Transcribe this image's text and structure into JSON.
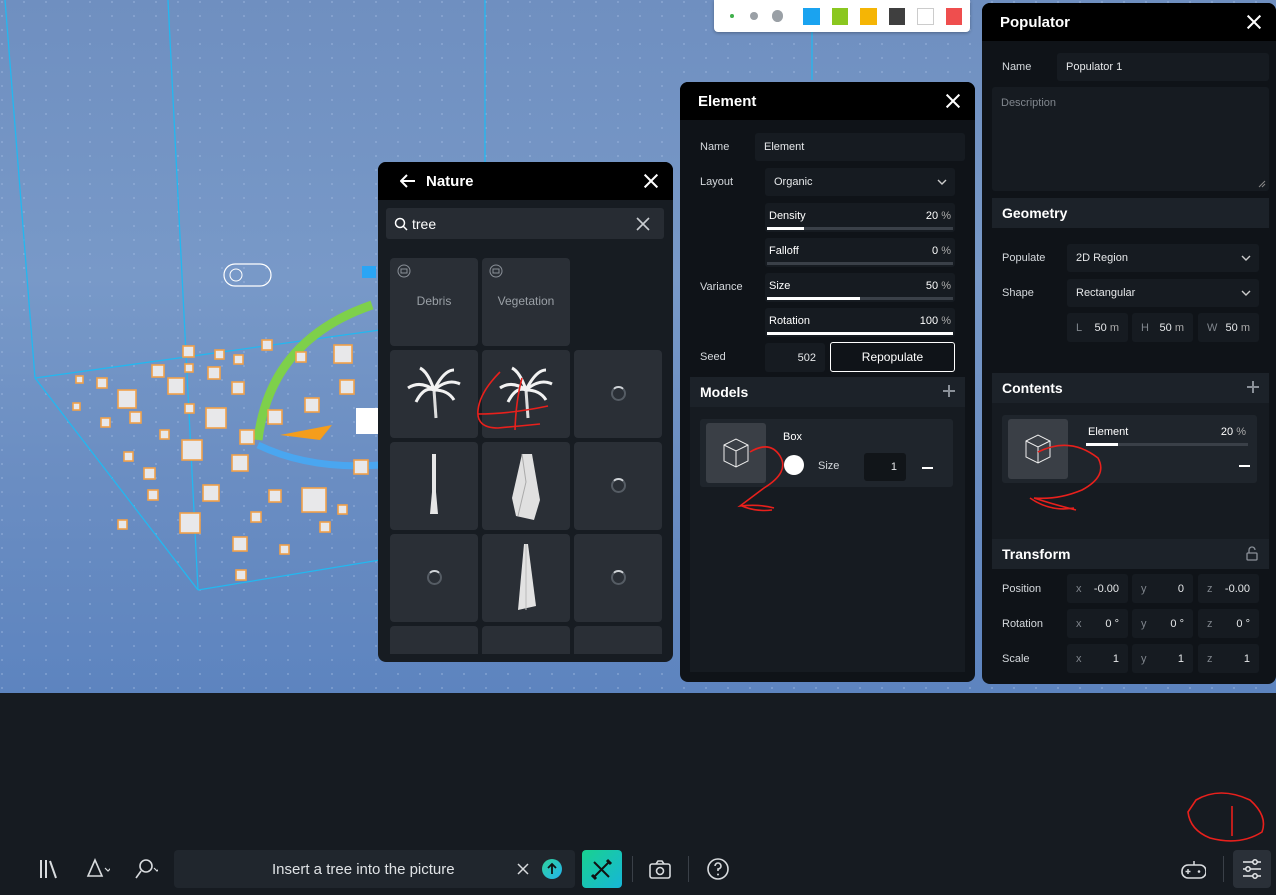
{
  "color_toolbar": {
    "brush_sizes": [
      "small",
      "medium",
      "large"
    ],
    "swatches": [
      "#1aa3f0",
      "#8ac720",
      "#f5b505",
      "#3f3f3f",
      "#ffffff",
      "#ef4e4e"
    ]
  },
  "nature_panel": {
    "title": "Nature",
    "search_value": "tree",
    "folders": [
      "Debris",
      "Vegetation"
    ]
  },
  "element_panel": {
    "title": "Element",
    "name_label": "Name",
    "name_value": "Element",
    "layout_label": "Layout",
    "layout_value": "Organic",
    "density": {
      "label": "Density",
      "value": "20",
      "unit": "%",
      "fraction": 0.2
    },
    "falloff": {
      "label": "Falloff",
      "value": "0",
      "unit": "%",
      "fraction": 0.0
    },
    "variance_label": "Variance",
    "size": {
      "label": "Size",
      "value": "50",
      "unit": "%",
      "fraction": 0.5
    },
    "rotation": {
      "label": "Rotation",
      "value": "100",
      "unit": "%",
      "fraction": 1.0
    },
    "seed_label": "Seed",
    "seed_value": "502",
    "repopulate_label": "Repopulate",
    "models_title": "Models",
    "model": {
      "name": "Box",
      "size_label": "Size",
      "size_value": "1"
    }
  },
  "populator_panel": {
    "title": "Populator",
    "name_label": "Name",
    "name_value": "Populator 1",
    "description_placeholder": "Description",
    "geometry_title": "Geometry",
    "populate_label": "Populate",
    "populate_value": "2D Region",
    "shape_label": "Shape",
    "shape_value": "Rectangular",
    "dims": [
      {
        "axis": "L",
        "value": "50",
        "unit": "m"
      },
      {
        "axis": "H",
        "value": "50",
        "unit": "m"
      },
      {
        "axis": "W",
        "value": "50",
        "unit": "m"
      }
    ],
    "contents_title": "Contents",
    "content_item": {
      "name": "Element",
      "value": "20",
      "unit": "%",
      "fraction": 0.2
    },
    "transform_title": "Transform",
    "position_label": "Position",
    "rotation_label": "Rotation",
    "scale_label": "Scale",
    "position": [
      {
        "axis": "x",
        "value": "-0.00"
      },
      {
        "axis": "y",
        "value": "0"
      },
      {
        "axis": "z",
        "value": "-0.00"
      }
    ],
    "rotation": [
      {
        "axis": "x",
        "value": "0 °"
      },
      {
        "axis": "y",
        "value": "0 °"
      },
      {
        "axis": "z",
        "value": "0 °"
      }
    ],
    "scale": [
      {
        "axis": "x",
        "value": "1"
      },
      {
        "axis": "y",
        "value": "1"
      },
      {
        "axis": "z",
        "value": "1"
      }
    ]
  },
  "bottom_bar": {
    "prompt_text": "Insert a tree into the picture"
  },
  "annotations": {
    "marks": [
      "1",
      "2",
      "2",
      "4"
    ],
    "color": "#e8201c"
  }
}
